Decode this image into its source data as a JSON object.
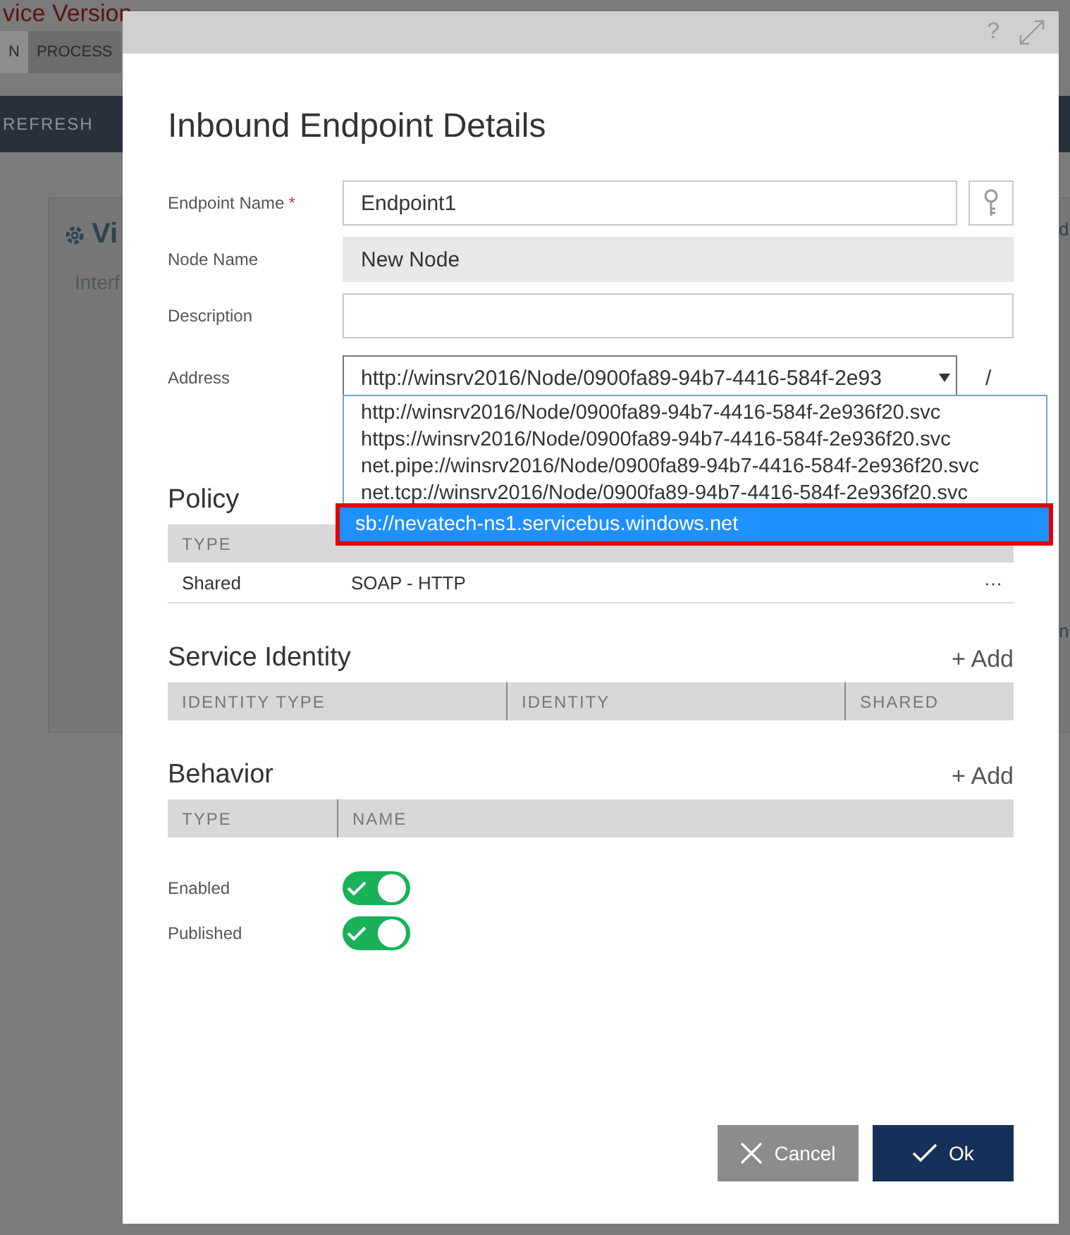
{
  "background": {
    "title": "vice Version",
    "tabs": [
      {
        "label": "N",
        "selected": true
      },
      {
        "label": "PROCESS",
        "selected": false
      }
    ],
    "refresh_button": "REFRESH",
    "panel_title": "Vi",
    "panel_subtitle": "Interf",
    "edge_texts": [
      "d",
      "n"
    ]
  },
  "dialog": {
    "help": "?",
    "title": "Inbound Endpoint Details",
    "endpoint_name": {
      "label": "Endpoint Name",
      "required": true,
      "required_mark": "*",
      "value": "Endpoint1"
    },
    "node_name": {
      "label": "Node Name",
      "value": "New Node",
      "disabled": true
    },
    "description": {
      "label": "Description"
    },
    "address": {
      "label": "Address",
      "value": "http://winsrv2016/Node/0900fa89-94b7-4416-584f-2e93",
      "suffix": "/",
      "expanded": true,
      "options": [
        {
          "label": "http://winsrv2016/Node/0900fa89-94b7-4416-584f-2e936f20.svc",
          "selected": false
        },
        {
          "label": "https://winsrv2016/Node/0900fa89-94b7-4416-584f-2e936f20.svc",
          "selected": false
        },
        {
          "label": "net.pipe://winsrv2016/Node/0900fa89-94b7-4416-584f-2e936f20.svc",
          "selected": false
        },
        {
          "label": "net.tcp://winsrv2016/Node/0900fa89-94b7-4416-584f-2e936f20.svc",
          "selected": false
        },
        {
          "label": "sb://nevatech-ns1.servicebus.windows.net",
          "selected": true
        }
      ]
    },
    "policy": {
      "title": "Policy",
      "columns": [
        "TYPE"
      ],
      "rows": [
        {
          "type": "Shared",
          "name": "SOAP - HTTP",
          "menu": "···"
        }
      ]
    },
    "service_identity": {
      "title": "Service Identity",
      "add": "+ Add",
      "columns": [
        "IDENTITY TYPE",
        "IDENTITY",
        "SHARED"
      ]
    },
    "behavior": {
      "title": "Behavior",
      "add": "+ Add",
      "columns": [
        "TYPE",
        "NAME"
      ]
    },
    "switches": [
      {
        "label": "Enabled",
        "on": true
      },
      {
        "label": "Published",
        "on": true
      }
    ],
    "buttons": [
      {
        "kind": "cancel",
        "label": "Cancel"
      },
      {
        "kind": "ok",
        "label": "Ok"
      }
    ]
  }
}
